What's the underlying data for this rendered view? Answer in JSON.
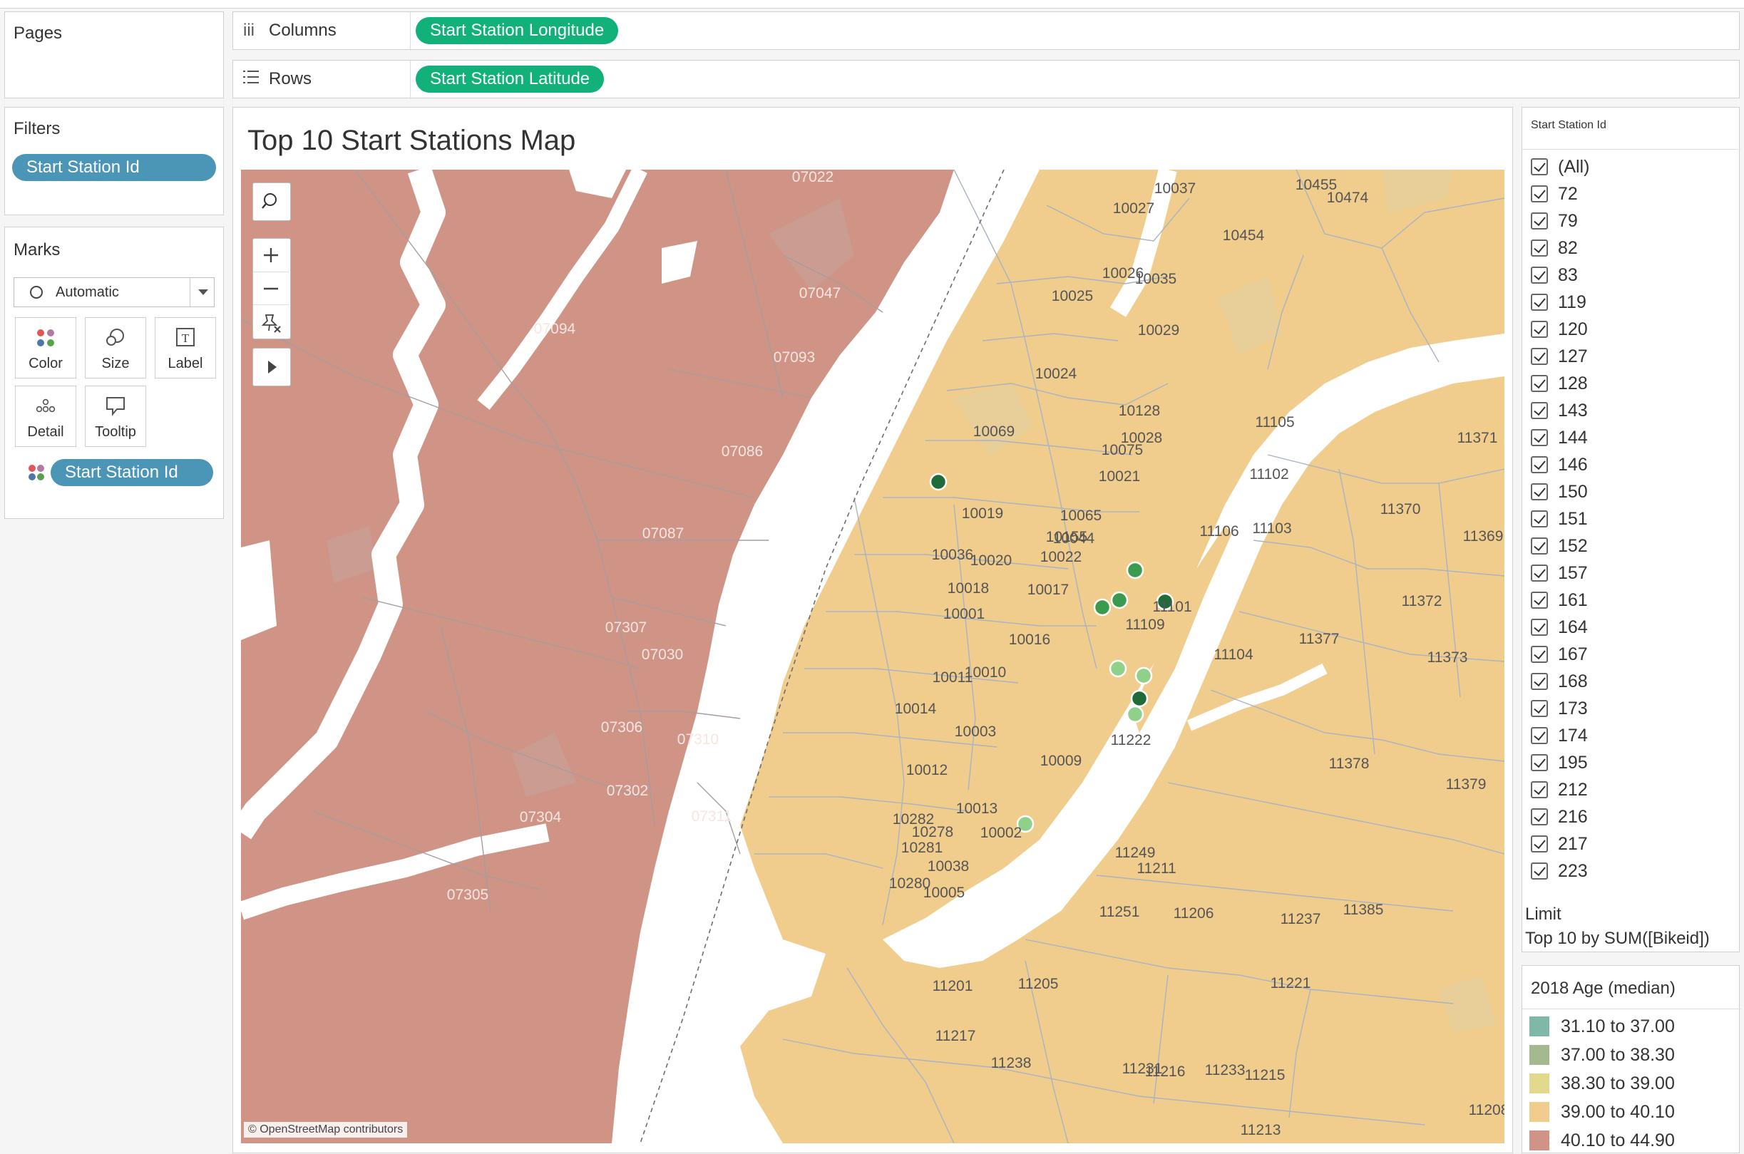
{
  "shelves": {
    "pages_label": "Pages",
    "columns_label": "Columns",
    "rows_label": "Rows",
    "columns_pill": "Start Station Longitude",
    "rows_pill": "Start Station Latitude"
  },
  "filters": {
    "title": "Filters",
    "pill": "Start Station Id"
  },
  "marks": {
    "title": "Marks",
    "type": "Automatic",
    "buttons": [
      "Color",
      "Size",
      "Label",
      "Detail",
      "Tooltip"
    ],
    "color_pill": "Start Station Id"
  },
  "worksheet": {
    "title": "Top 10 Start Stations Map",
    "attribution": "© OpenStreetMap contributors"
  },
  "map_labels": {
    "new_jersey": [
      "07022",
      "07047",
      "07094",
      "07093",
      "07086",
      "07087",
      "07307",
      "07030",
      "07306",
      "07310",
      "07302",
      "07311",
      "07304",
      "07305"
    ],
    "new_york": [
      "10037",
      "10027",
      "10455",
      "10474",
      "10454",
      "10026",
      "10035",
      "10025",
      "10029",
      "10024",
      "10128",
      "10028",
      "10075",
      "10069",
      "10021",
      "10019",
      "10065",
      "10155",
      "10036",
      "10020",
      "10022",
      "10044",
      "10018",
      "10017",
      "10001",
      "10016",
      "10010",
      "10011",
      "10003",
      "10014",
      "10009",
      "10012",
      "10013",
      "10278",
      "10282",
      "10281",
      "10002",
      "10038",
      "10280",
      "10005",
      "11105",
      "11371",
      "11102",
      "11370",
      "11106",
      "11103",
      "11369",
      "11101",
      "11109",
      "11372",
      "11377",
      "11104",
      "11373",
      "11222",
      "11378",
      "11379",
      "11249",
      "11211",
      "11251",
      "11206",
      "11237",
      "11385",
      "11201",
      "11205",
      "11221",
      "11217",
      "11231",
      "11238",
      "11216",
      "11233",
      "11215",
      "11213",
      "11208"
    ]
  },
  "station_filter": {
    "title": "Start Station Id",
    "items": [
      "(All)",
      "72",
      "79",
      "82",
      "83",
      "119",
      "120",
      "127",
      "128",
      "143",
      "144",
      "146",
      "150",
      "151",
      "152",
      "157",
      "161",
      "164",
      "167",
      "168",
      "173",
      "174",
      "195",
      "212",
      "216",
      "217",
      "223"
    ],
    "limit_label": "Limit",
    "limit_value": "Top 10 by SUM([Bikeid])"
  },
  "age_legend": {
    "title": "2018 Age (median)",
    "items": [
      {
        "label": "31.10 to 37.00",
        "color": "#7fb8a6"
      },
      {
        "label": "37.00 to 38.30",
        "color": "#a5b98e"
      },
      {
        "label": "38.30 to 39.00",
        "color": "#e3d98c"
      },
      {
        "label": "39.00 to 40.10",
        "color": "#f0cd8c"
      },
      {
        "label": "40.10 to 44.90",
        "color": "#cf9486"
      }
    ]
  },
  "colors": {
    "pill_green": "#12b17a",
    "pill_blue": "#4b95b6",
    "nj_fill": "#cf9486",
    "ny_fill": "#f0cd8c",
    "water": "#ffffff",
    "station_dark": "#1f6b3a",
    "station_mid": "#3a9a4e",
    "station_light": "#8fd08a"
  }
}
